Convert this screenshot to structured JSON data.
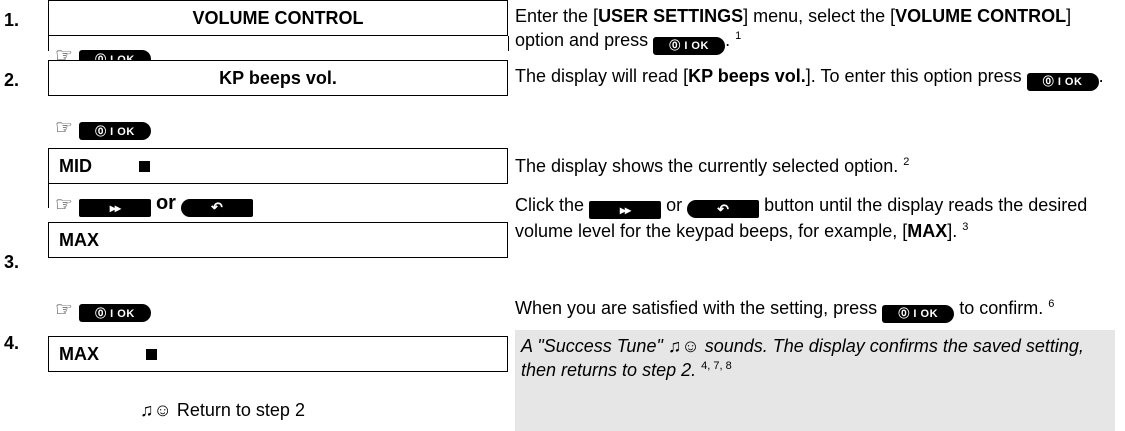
{
  "steps": {
    "s1": "1.",
    "s2": "2.",
    "s3": "3.",
    "s4": "4."
  },
  "display": {
    "volume_control": "VOLUME CONTROL",
    "kp_beeps": "KP beeps vol.",
    "mid": "MID",
    "max1": "MAX",
    "max2": "MAX"
  },
  "buttons": {
    "ok": "⓪ I OK",
    "fwd": "▸▸",
    "back": "↶",
    "or": "or"
  },
  "desc": {
    "d1_a": "Enter the [",
    "d1_b": "USER SETTINGS",
    "d1_c": "] menu, select the [",
    "d1_d": "VOLUME CONTROL",
    "d1_e": "]",
    "d1_f": "option and press",
    "d1_g": ".",
    "d1_sup": "1",
    "d2_a": "The display will read [",
    "d2_b": "KP beeps vol.",
    "d2_c": "]. To enter this option press",
    "d2_d": ".",
    "d3": "The display shows the currently selected option.",
    "d3_sup": "2",
    "d4_a": "Click the",
    "d4_or": "or",
    "d4_b": "button until the display reads the desired",
    "d4_c": "volume level for the keypad beeps, for example, [",
    "d4_d": "MAX",
    "d4_e": "].",
    "d4_sup": "3",
    "d5_a": "When you are satisfied with the setting, press",
    "d5_b": "to confirm.",
    "d5_sup": "6",
    "d6_a": "A \"Success Tune\" ♫☺ sounds. The display confirms the saved setting,",
    "d6_b": "then returns to step 2",
    "d6_c": ".",
    "d6_sup": "4, 7, 8",
    "return": "♫☺ Return to step 2"
  }
}
